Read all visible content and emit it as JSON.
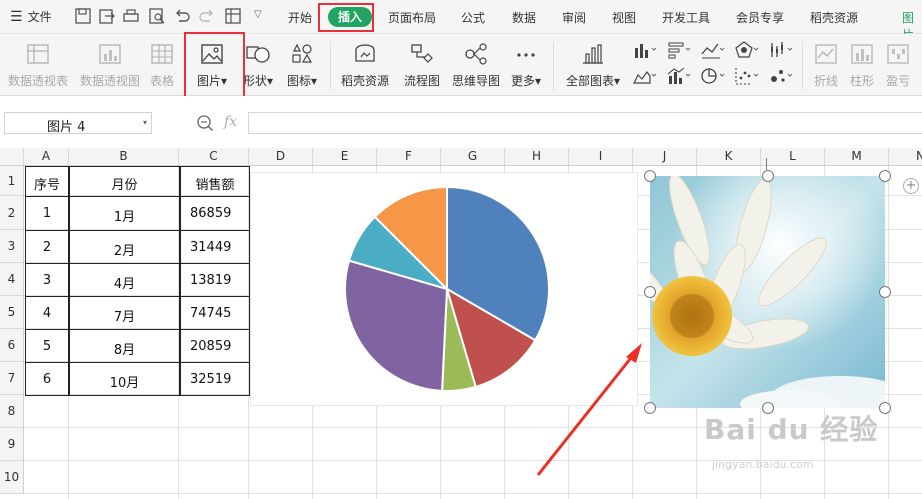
{
  "menu": {
    "file_label": "文件",
    "tabs": [
      "开始",
      "插入",
      "页面布局",
      "公式",
      "数据",
      "审阅",
      "视图",
      "开发工具",
      "会员专享",
      "稻壳资源",
      "图片"
    ],
    "active_tab": "插入"
  },
  "ribbon": {
    "items": [
      {
        "label": "数据透视表",
        "disabled": true
      },
      {
        "label": "数据透视图",
        "disabled": true
      },
      {
        "label": "表格",
        "disabled": true
      },
      {
        "label": "图片▾",
        "disabled": false
      },
      {
        "label": "形状▾",
        "disabled": false
      },
      {
        "label": "图标▾",
        "disabled": false
      },
      {
        "label": "稻壳资源",
        "disabled": false
      },
      {
        "label": "流程图",
        "disabled": false
      },
      {
        "label": "思维导图",
        "disabled": false
      },
      {
        "label": "更多▾",
        "disabled": false
      },
      {
        "label": "全部图表▾",
        "disabled": false
      },
      {
        "label": "折线",
        "disabled": true
      },
      {
        "label": "柱形",
        "disabled": true
      },
      {
        "label": "盈亏",
        "disabled": true
      }
    ]
  },
  "formula_bar": {
    "name_box": "图片 4",
    "fx_symbol": "fx"
  },
  "columns": [
    "A",
    "B",
    "C",
    "D",
    "E",
    "F",
    "G",
    "H",
    "I",
    "J",
    "K",
    "L",
    "M",
    "N"
  ],
  "rows": [
    "1",
    "2",
    "3",
    "4",
    "5",
    "6",
    "7",
    "8",
    "9",
    "10"
  ],
  "table": {
    "headers": [
      "序号",
      "月份",
      "销售额"
    ],
    "rows": [
      [
        "1",
        "1月",
        "86859"
      ],
      [
        "2",
        "2月",
        "31449"
      ],
      [
        "3",
        "4月",
        "13819"
      ],
      [
        "4",
        "7月",
        "74745"
      ],
      [
        "5",
        "8月",
        "20859"
      ],
      [
        "6",
        "10月",
        "32519"
      ]
    ]
  },
  "chart_data": {
    "type": "pie",
    "categories": [
      "1月",
      "2月",
      "4月",
      "7月",
      "8月",
      "10月"
    ],
    "values": [
      86859,
      31449,
      13819,
      74745,
      20859,
      32519
    ],
    "colors": [
      "#4f81bd",
      "#c0504d",
      "#9bbb59",
      "#8064a2",
      "#4bacc6",
      "#f79646"
    ]
  },
  "watermark": {
    "text": "Bai du 经验",
    "url": "jingyan.baidu.com"
  }
}
